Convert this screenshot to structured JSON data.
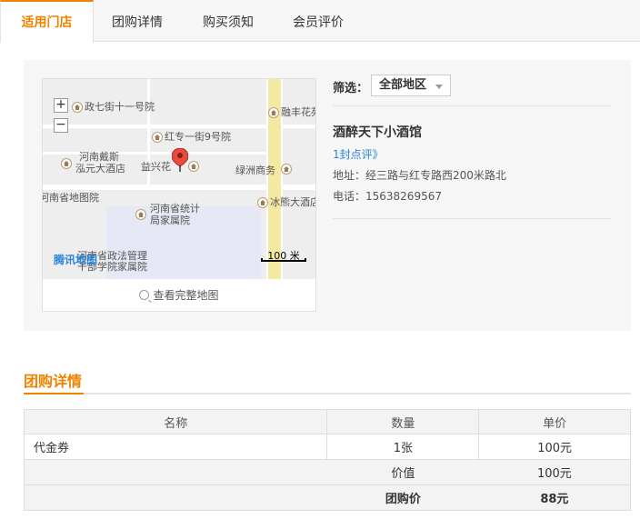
{
  "tabs": [
    {
      "label": "适用门店",
      "active": true
    },
    {
      "label": "团购详情",
      "active": false
    },
    {
      "label": "购买须知",
      "active": false
    },
    {
      "label": "会员评价",
      "active": false
    }
  ],
  "map": {
    "zoom_in": "+",
    "zoom_out": "−",
    "pois": [
      "政七街十一号院",
      "融丰花苑",
      "红专一街9号院",
      "河南戴斯",
      "泓元大酒店",
      "益兴花",
      "绿洲商务",
      "河南省地图院",
      "冰熊大酒店",
      "河南省统计",
      "局家属院",
      "河南省政法管理",
      "干部学院家属院"
    ],
    "scale_label": "100 米",
    "logo": "腾讯地图",
    "view_full_label": "查看完整地图"
  },
  "filter": {
    "label": "筛选：",
    "selected": "全部地区"
  },
  "shop": {
    "name": "酒醉天下小酒馆",
    "reviews": "1封点评》",
    "address": "地址：经三路与红专路西200米路北",
    "phone": "电话：15638269567"
  },
  "section": {
    "title": "团购详情"
  },
  "table": {
    "headers": [
      "名称",
      "数量",
      "单价"
    ],
    "row": {
      "name": "代金券",
      "qty": "1张",
      "price": "100元"
    },
    "value_label": "价值",
    "value": "100元",
    "group_label": "团购价",
    "group_price": "88元"
  },
  "colors": {
    "accent": "#f08200",
    "link": "#2b86d9"
  }
}
